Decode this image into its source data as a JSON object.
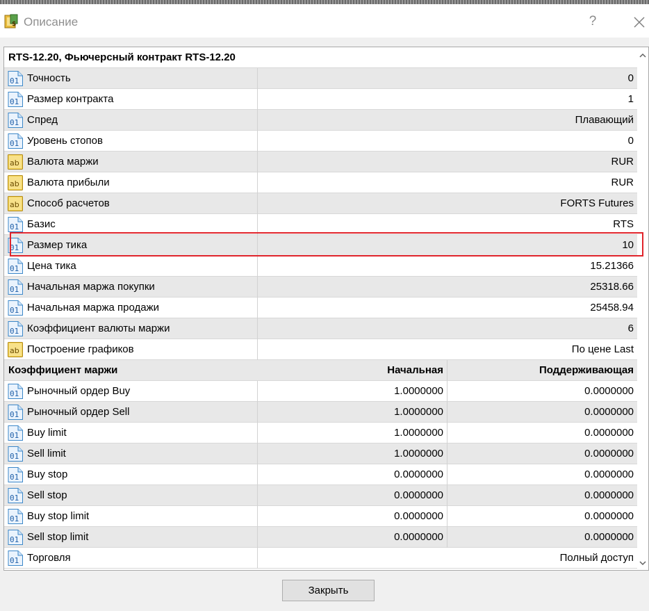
{
  "window": {
    "title": "Описание",
    "help_label": "?"
  },
  "header": {
    "title": "RTS-12.20, Фьючерсный контракт RTS-12.20"
  },
  "properties": [
    {
      "icon": "numeric-icon",
      "label": "Точность",
      "value": "0"
    },
    {
      "icon": "numeric-icon",
      "label": "Размер контракта",
      "value": "1"
    },
    {
      "icon": "numeric-icon",
      "label": "Спред",
      "value": "Плавающий"
    },
    {
      "icon": "numeric-icon",
      "label": "Уровень стопов",
      "value": "0"
    },
    {
      "icon": "text-icon",
      "label": "Валюта маржи",
      "value": "RUR"
    },
    {
      "icon": "text-icon",
      "label": "Валюта прибыли",
      "value": "RUR"
    },
    {
      "icon": "text-icon",
      "label": "Способ расчетов",
      "value": "FORTS Futures"
    },
    {
      "icon": "numeric-icon",
      "label": "Базис",
      "value": "RTS"
    },
    {
      "icon": "numeric-icon",
      "label": "Размер тика",
      "value": "10"
    },
    {
      "icon": "numeric-icon",
      "label": "Цена тика",
      "value": "15.21366"
    },
    {
      "icon": "numeric-icon",
      "label": "Начальная маржа покупки",
      "value": "25318.66"
    },
    {
      "icon": "numeric-icon",
      "label": "Начальная маржа продажи",
      "value": "25458.94"
    },
    {
      "icon": "numeric-icon",
      "label": "Коэффициент валюты маржи",
      "value": "6"
    },
    {
      "icon": "text-icon",
      "label": "Построение графиков",
      "value": "По цене Last"
    }
  ],
  "margin_table": {
    "header": {
      "label": "Коэффициент маржи",
      "initial": "Начальная",
      "maintenance": "Поддерживающая"
    },
    "rows": [
      {
        "icon": "numeric-icon",
        "label": "Рыночный ордер Buy",
        "initial": "1.0000000",
        "maintenance": "0.0000000"
      },
      {
        "icon": "numeric-icon",
        "label": "Рыночный ордер Sell",
        "initial": "1.0000000",
        "maintenance": "0.0000000"
      },
      {
        "icon": "numeric-icon",
        "label": "Buy limit",
        "initial": "1.0000000",
        "maintenance": "0.0000000"
      },
      {
        "icon": "numeric-icon",
        "label": "Sell limit",
        "initial": "1.0000000",
        "maintenance": "0.0000000"
      },
      {
        "icon": "numeric-icon",
        "label": "Buy stop",
        "initial": "0.0000000",
        "maintenance": "0.0000000"
      },
      {
        "icon": "numeric-icon",
        "label": "Sell stop",
        "initial": "0.0000000",
        "maintenance": "0.0000000"
      },
      {
        "icon": "numeric-icon",
        "label": "Buy stop limit",
        "initial": "0.0000000",
        "maintenance": "0.0000000"
      },
      {
        "icon": "numeric-icon",
        "label": "Sell stop limit",
        "initial": "0.0000000",
        "maintenance": "0.0000000"
      }
    ]
  },
  "trading": {
    "icon": "numeric-icon",
    "label": "Торговля",
    "value": "Полный доступ"
  },
  "footer": {
    "close_label": "Закрыть"
  },
  "colors": {
    "highlight": "#e0242b",
    "row_alt": "#e8e8e8"
  }
}
